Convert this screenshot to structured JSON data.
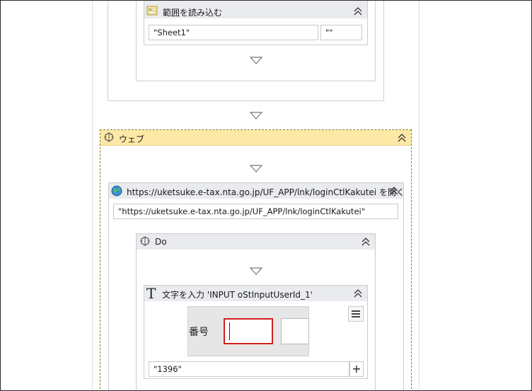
{
  "read_range": {
    "title": "範囲を読み込む",
    "sheet_value": "\"Sheet1\"",
    "range_value": "\"\""
  },
  "web_scope": {
    "title": "ウェブ"
  },
  "open_browser": {
    "title": "https://uketsuke.e-tax.nta.go.jp/UF_APP/lnk/loginCtlKakutei を開く",
    "url_value": "\"https://uketsuke.e-tax.nta.go.jp/UF_APP/lnk/loginCtlKakutei\""
  },
  "do_scope": {
    "title": "Do"
  },
  "type_into": {
    "icon_glyph": "T",
    "title": "文字を入力 'INPUT  oStInputUserId_1'",
    "preview_label": "番号",
    "text_value": "\"1396\"",
    "plus_label": "+"
  },
  "colors": {
    "web_header": "#fde8a6",
    "activity_header": "#e9ebee",
    "highlight_border": "#d11f1f"
  },
  "icons": [
    "excel-range-icon",
    "collapse-icon",
    "sequence-arrow-icon",
    "browser-scope-icon",
    "globe-icon",
    "hamburger-menu-icon",
    "type-into-icon"
  ]
}
